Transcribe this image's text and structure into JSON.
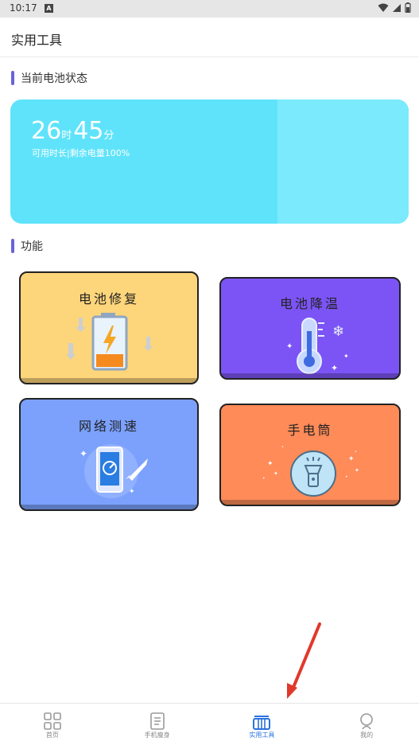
{
  "status_bar": {
    "time": "10:17",
    "notification_glyph": "A"
  },
  "app_bar": {
    "title": "实用工具"
  },
  "battery_section": {
    "heading": "当前电池状态",
    "hours": "26",
    "hours_unit": "时",
    "minutes": "45",
    "minutes_unit": "分",
    "caption": "可用时长|剩余电量100%",
    "battery_level_fraction": 0.67
  },
  "features_section": {
    "heading": "功能",
    "tiles": [
      {
        "label": "电池修复",
        "icon": "battery-charging-icon",
        "color": "#fdd57a"
      },
      {
        "label": "电池降温",
        "icon": "thermometer-snow-icon",
        "color": "#7c54f5"
      },
      {
        "label": "网络测速",
        "icon": "phone-rocket-icon",
        "color": "#7ba1fd"
      },
      {
        "label": "手电筒",
        "icon": "flashlight-icon",
        "color": "#fe8b58"
      }
    ]
  },
  "bottom_nav": {
    "items": [
      {
        "label": "首页",
        "icon": "grid-icon"
      },
      {
        "label": "手机瘦身",
        "icon": "document-icon"
      },
      {
        "label": "实用工具",
        "icon": "toolbox-icon",
        "active": true
      },
      {
        "label": "我的",
        "icon": "person-icon"
      }
    ]
  },
  "colors": {
    "accent": "#6b63d8",
    "active_nav": "#2b73e0",
    "battery_card": "#5fe3fa",
    "arrow": "#e0392b"
  }
}
